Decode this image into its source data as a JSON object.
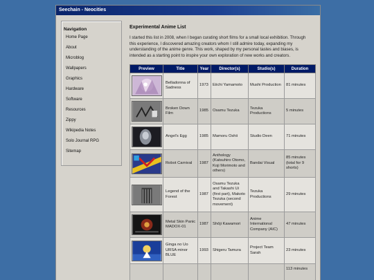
{
  "window": {
    "title": "Seechain - Neocities"
  },
  "nav": {
    "title": "Navigation",
    "items": [
      "Home Page",
      "About",
      "Microblog",
      "Wallpapers",
      "Graphics",
      "Hardware",
      "Software",
      "Resources",
      "Zippy",
      "Wikipedia Notes",
      "Solo Journal RPG",
      "Sitemap"
    ]
  },
  "main": {
    "heading": "Experimental Anime List",
    "intro": "I started this list in 2008, when I began curating short films for a small local exhibition. Through this experience, I discovered amazing creators whom I still admire today, expanding my understanding of the anime genre. This work, shaped by my personal tastes and biases, is intended as a starting point to inspire your own exploration of new works and creators."
  },
  "table": {
    "headers": [
      "Preview",
      "Title",
      "Year",
      "Director(s)",
      "Studio(s)",
      "Duration"
    ],
    "rows": [
      {
        "title": "Belladonna of Sadness",
        "year": "1973",
        "director": "Eiichi Yamamoto",
        "studio": "Mushi Production",
        "duration": "81 minutes"
      },
      {
        "title": "Broken Down Film",
        "year": "1985",
        "director": "Osamu Tezuka",
        "studio": "Tezuka Productions",
        "duration": "5 minutes"
      },
      {
        "title": "Angel's Egg",
        "year": "1985",
        "director": "Mamoru Oshii",
        "studio": "Studio Deen",
        "duration": "71 minutes"
      },
      {
        "title": "Robot Carnival",
        "year": "1987",
        "director": "Anthology (Katsuhiro Otomo, Koji Morimoto and others)",
        "studio": "Bandai Visual",
        "duration": "85 minutes (total for 9 shorts)"
      },
      {
        "title": "Legend of the Forest",
        "year": "1987",
        "director": "Osamu Tezuka and Takashi Ui (first part), Makoto Tezuka (second movement)",
        "studio": "Tezuka Productions",
        "duration": "29 minutes"
      },
      {
        "title": "Metal Skin Panic MADOX-01",
        "year": "1987",
        "director": "Shōji Kawamori",
        "studio": "Anime International Company (AIC)",
        "duration": "47 minutes"
      },
      {
        "title": "Ginga no Uo URSA minor BLUE",
        "year": "1993",
        "director": "Shigeru Tamura",
        "studio": "Project Team Sarah",
        "duration": "23 minutes"
      },
      {
        "title": "",
        "year": "",
        "director": "",
        "studio": "",
        "duration": "113 minutes"
      }
    ]
  }
}
